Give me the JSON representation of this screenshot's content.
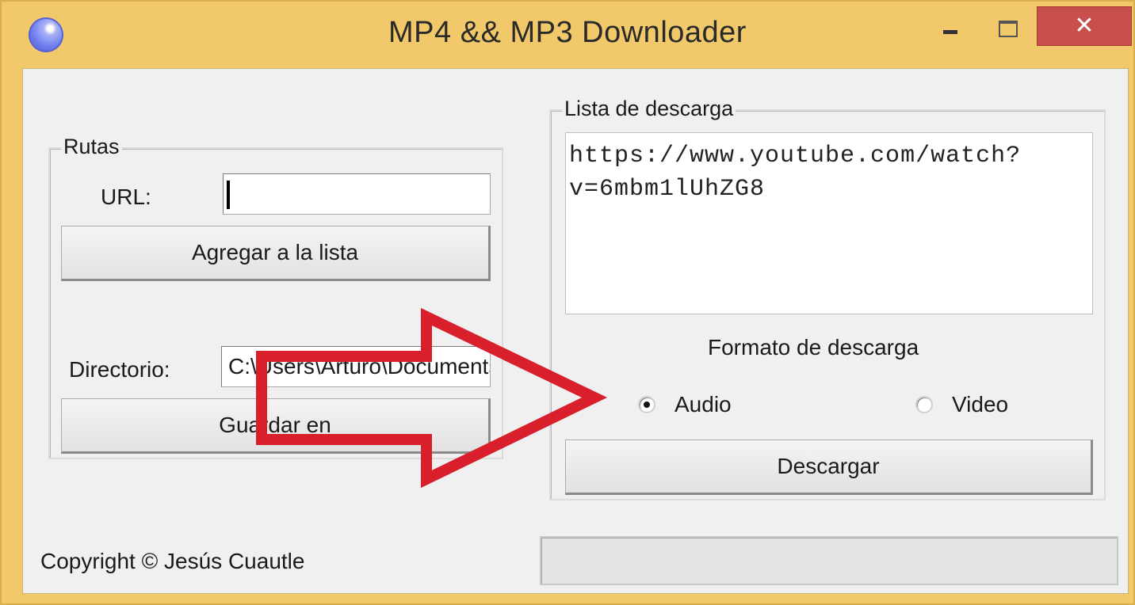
{
  "window": {
    "title": "MP4 && MP3 Downloader",
    "close_glyph": "✕"
  },
  "rutas": {
    "legend": "Rutas",
    "url_label": "URL:",
    "url_value": "",
    "add_button": "Agregar a la lista",
    "dir_label": "Directorio:",
    "dir_value": "C:\\Users\\Arturo\\Documents",
    "save_button": "Guardar en"
  },
  "lista": {
    "legend": "Lista de descarga",
    "items": [
      "https://www.youtube.com/watch?",
      "v=6mbm1lUhZG8"
    ]
  },
  "formato": {
    "label": "Formato de descarga",
    "options": [
      {
        "label": "Audio",
        "checked": true
      },
      {
        "label": "Video",
        "checked": false
      }
    ],
    "download_button": "Descargar"
  },
  "footer": {
    "copyright": "Copyright © Jesús Cuautle",
    "progress": 0
  },
  "colors": {
    "frame": "#f2c96a",
    "close_button": "#c7504d",
    "arrow": "#d81f2b"
  },
  "icons": {
    "app": "app-orb-icon",
    "minimize": "minimize-icon",
    "maximize": "maximize-icon",
    "close": "close-icon",
    "annotation": "red-arrow-icon"
  }
}
